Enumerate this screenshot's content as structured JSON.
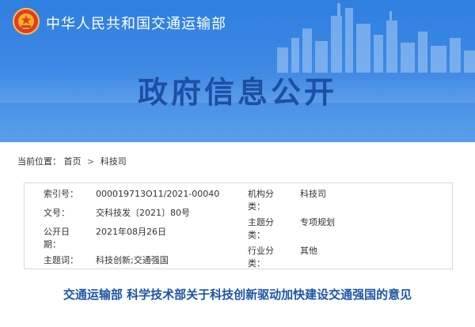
{
  "header": {
    "ministry_name": "中华人民共和国交通运输部",
    "page_heading": "政府信息公开"
  },
  "breadcrumb": {
    "label": "当前位置：",
    "items": [
      "首页",
      "科技司"
    ],
    "separator": ">"
  },
  "metadata": {
    "index_no_label": "索引号：",
    "index_no_value": "000019713O11/2021-00040",
    "doc_no_label": "文号：",
    "doc_no_value": "交科技发〔2021〕80号",
    "publish_date_label_line1": "公开日",
    "publish_date_label_line2": "期：",
    "publish_date_value": "2021年08月26日",
    "keywords_label": "主题词：",
    "keywords_value": "科技创新;交通强国",
    "agency_label_line1": "机构分",
    "agency_label_line2": "类：",
    "agency_value": "科技司",
    "topic_label_line1": "主题分",
    "topic_label_line2": "类：",
    "topic_value": "专项规划",
    "industry_label_line1": "行业分",
    "industry_label_line2": "类：",
    "industry_value": "其他"
  },
  "document": {
    "title": "交通运输部 科学技术部关于科技创新驱动加快建设交通强国的意见"
  },
  "colors": {
    "banner_blue": "#2f7fe0",
    "heading_blue": "#1d4fa3",
    "title_blue": "#1b55a8"
  }
}
